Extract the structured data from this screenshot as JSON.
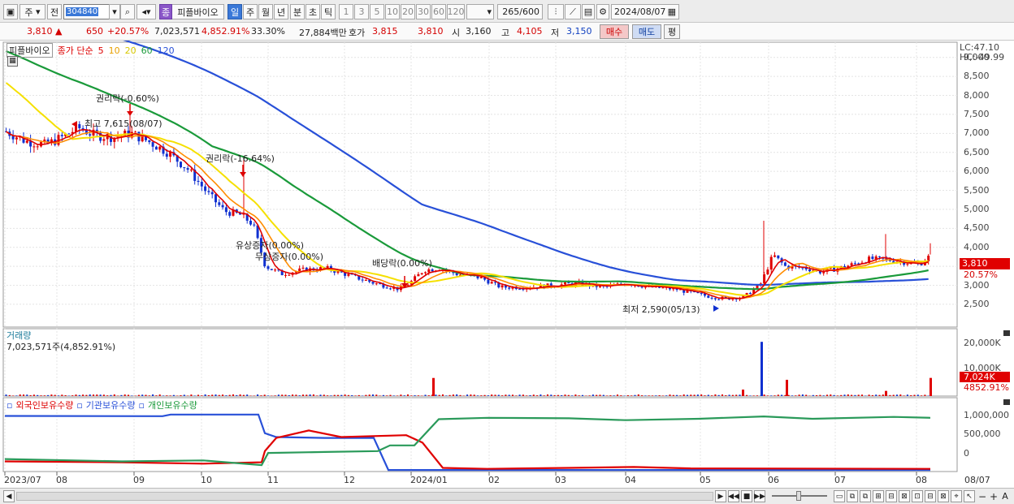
{
  "toolbar": {
    "period_select": "주",
    "prev_label": "전",
    "stock_code": "304840",
    "stock_badge": "종",
    "stock_name": "피플바이오",
    "periods": [
      "일",
      "주",
      "월",
      "년",
      "분",
      "초",
      "틱"
    ],
    "minutes": [
      "1",
      "3",
      "5",
      "10",
      "20",
      "30",
      "60",
      "120"
    ],
    "count": "265",
    "count_total": "/600",
    "date": "2024/08/07"
  },
  "quote": {
    "price": "3,810",
    "arrow": "▲",
    "change": "650",
    "change_pct": "+20.57%",
    "volume": "7,023,571",
    "volume_pct": "4,852.91%",
    "turnover": "33.30%",
    "amount": "27,884백만",
    "bid_label": "호가",
    "bid": "3,815",
    "ask": "3,810",
    "open_label": "시",
    "open": "3,160",
    "high_label": "고",
    "high": "4,105",
    "low_label": "저",
    "low": "3,150",
    "buy_label": "매수",
    "sell_label": "매도",
    "eval_label": "평"
  },
  "price_pane": {
    "stock_name": "피플바이오",
    "ma_title": "종가 단순",
    "ma_periods": [
      "5",
      "10",
      "20",
      "60",
      "120"
    ],
    "lc": "LC:47.10",
    "hc": "HC:-49.99",
    "y_ticks": [
      "9,000",
      "8,500",
      "8,000",
      "7,500",
      "7,000",
      "6,500",
      "6,000",
      "5,500",
      "5,000",
      "4,500",
      "4,000",
      "3,500",
      "3,000",
      "2,500"
    ],
    "current_price": "3,810",
    "current_pct": "20.57%",
    "annotations": {
      "ex_right_1": "권리락(-0.60%)",
      "high_note": "최고 7,615(08/07)",
      "ex_right_2": "권리락(-16.64%)",
      "paid_increase": "유상증자(0.00%)",
      "free_increase": "무상증자(0.00%)",
      "dividend": "배당락(0.00%)",
      "low_note": "최저 2,590(05/13)"
    }
  },
  "volume_pane": {
    "title": "거래량",
    "value": "7,023,571주(4,852.91%)",
    "y_ticks": [
      "20,000K",
      "10,000K"
    ],
    "current": "7,024K",
    "current_pct": "4852.91%"
  },
  "holdings_pane": {
    "series": [
      "외국인보유수량",
      "기관보유수량",
      "개인보유수량"
    ],
    "y_ticks": [
      "1,000,000",
      "500,000",
      "0"
    ]
  },
  "x_axis": [
    "2023/07",
    "08",
    "09",
    "10",
    "11",
    "12",
    "2024/01",
    "02",
    "03",
    "04",
    "05",
    "06",
    "07",
    "08"
  ],
  "x_right": "08/07",
  "colors": {
    "ma5": "#e00000",
    "ma10": "#ff8c00",
    "ma20": "#f5e000",
    "ma60": "#1a9a3a",
    "ma120": "#2850d8",
    "up": "#e00000",
    "down": "#1030d0",
    "foreign": "#2850d8",
    "institution": "#e00000",
    "individual": "#2a9a5a"
  }
}
